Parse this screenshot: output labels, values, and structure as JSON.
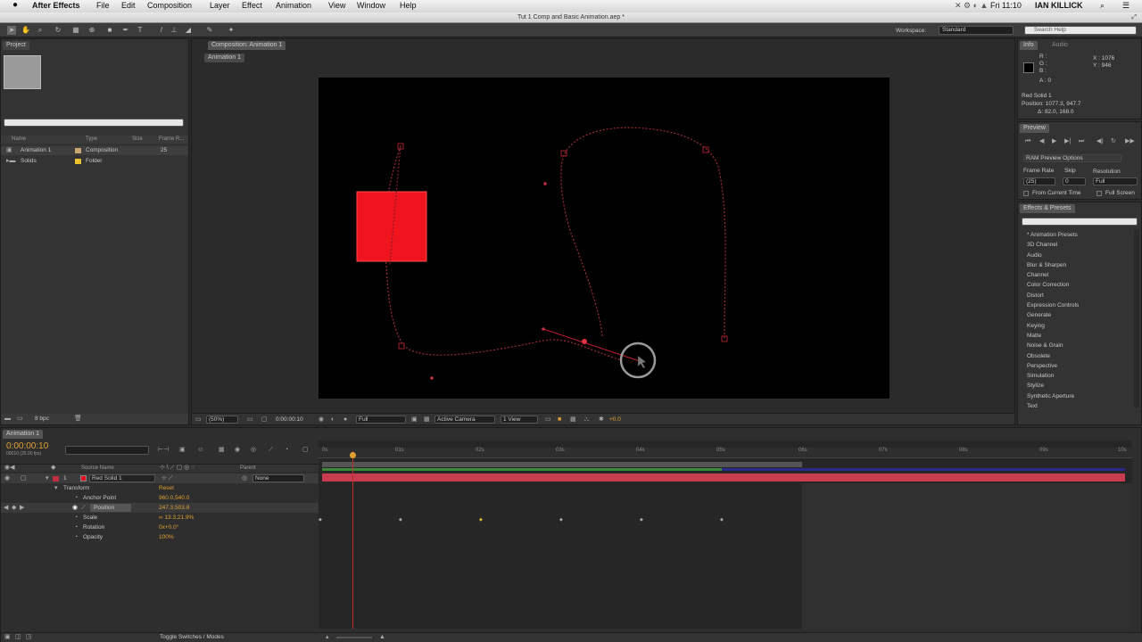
{
  "menubar": {
    "apple": "",
    "app": "After Effects",
    "items": [
      "File",
      "Edit",
      "Composition",
      "Layer",
      "Effect",
      "Animation",
      "View",
      "Window",
      "Help"
    ],
    "clock": "Fri 11:10",
    "user": "IAN KILLICK"
  },
  "window_title": "Tut 1 Comp and Basic Animation.aep *",
  "toolbar": {
    "workspace_label": "Workspace:",
    "workspace_value": "Standard",
    "search_placeholder": "Search Help"
  },
  "project": {
    "tab": "Project",
    "columns": [
      "Name",
      "Type",
      "Size",
      "Frame R..."
    ],
    "rows": [
      {
        "name": "Animation 1",
        "type": "Composition",
        "fr": "25",
        "color": "#c8a870"
      },
      {
        "name": "Solids",
        "type": "Folder",
        "fr": "",
        "color": "#e8c030"
      }
    ],
    "bpc": "8 bpc"
  },
  "composition": {
    "tab": "Composition: Animation 1",
    "sub_tab": "Animation 1",
    "zoom": "(50%)",
    "time": "0:00:00:10",
    "resolution": "Full",
    "camera": "Active Camera",
    "view": "1 View",
    "exposure": "+0.0"
  },
  "info": {
    "tab": "Info",
    "tab2": "Audio",
    "r": "R :",
    "g": "G :",
    "b": "B :",
    "a": "A : 0",
    "x": "X : 1076",
    "y": "Y : 946",
    "layer": "Red Solid 1",
    "position": "Position: 1077.3, 947.7",
    "delta": "Δ: 82.0, 168.0"
  },
  "preview": {
    "tab": "Preview",
    "ram": "RAM Preview Options",
    "frame_rate_label": "Frame Rate",
    "skip_label": "Skip",
    "resolution_label": "Resolution",
    "frame_rate": "(25)",
    "skip": "0",
    "resolution": "Full",
    "from_current": "From Current Time",
    "full_screen": "Full Screen"
  },
  "effects": {
    "tab": "Effects & Presets",
    "items": [
      "* Animation Presets",
      "3D Channel",
      "Audio",
      "Blur & Sharpen",
      "Channel",
      "Color Correction",
      "Distort",
      "Expression Controls",
      "Generate",
      "Keying",
      "Matte",
      "Noise & Grain",
      "Obsolete",
      "Perspective",
      "Simulation",
      "Stylize",
      "Synthetic Aperture",
      "Text"
    ]
  },
  "timeline": {
    "tab": "Animation 1",
    "timecode": "0:00:00:10",
    "timecode_sub": "00010 (25.00 fps)",
    "col_source": "Source Name",
    "col_parent": "Parent",
    "layer_num": "1",
    "layer_name": "Red Solid 1",
    "parent_value": "None",
    "properties": [
      {
        "name": "Transform",
        "value": "Reset"
      },
      {
        "name": "Anchor Point",
        "value": "960.0,540.0"
      },
      {
        "name": "Position",
        "value": "247.3,503.8"
      },
      {
        "name": "Scale",
        "value": "∞ 13.3,21.9%"
      },
      {
        "name": "Rotation",
        "value": "0x+0.0°"
      },
      {
        "name": "Opacity",
        "value": "100%"
      }
    ],
    "ruler": [
      "0s",
      "01s",
      "02s",
      "03s",
      "04s",
      "05s",
      "06s",
      "07s",
      "08s",
      "09s",
      "10s"
    ],
    "toggle_label": "Toggle Switches / Modes"
  },
  "colors": {
    "solid": "#f0141e",
    "accent": "#e0a030",
    "layer_bar": "#c83c50",
    "work_area": "#3a8a3a"
  }
}
